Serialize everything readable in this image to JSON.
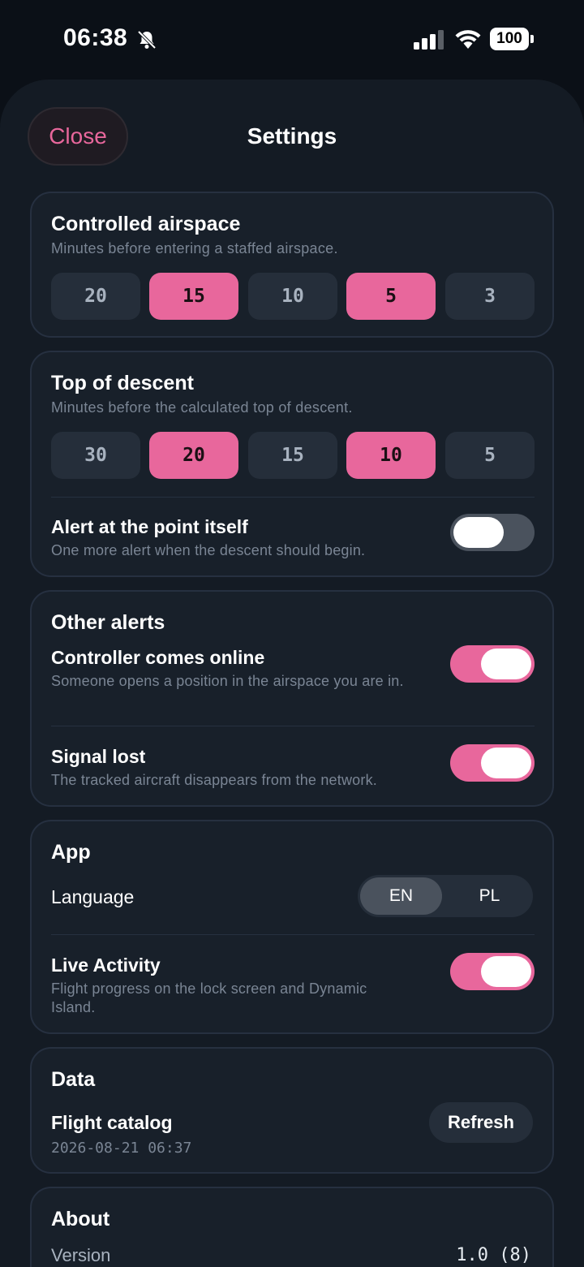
{
  "status_bar": {
    "time": "06:38",
    "battery": "100"
  },
  "header": {
    "close_label": "Close",
    "title": "Settings"
  },
  "controlled_airspace": {
    "title": "Controlled airspace",
    "subtitle": "Minutes before entering a staffed airspace.",
    "options": [
      {
        "label": "20",
        "selected": false
      },
      {
        "label": "15",
        "selected": true
      },
      {
        "label": "10",
        "selected": false
      },
      {
        "label": "5",
        "selected": true
      },
      {
        "label": "3",
        "selected": false
      }
    ]
  },
  "top_of_descent": {
    "title": "Top of descent",
    "subtitle": "Minutes before the calculated top of descent.",
    "options": [
      {
        "label": "30",
        "selected": false
      },
      {
        "label": "20",
        "selected": true
      },
      {
        "label": "15",
        "selected": false
      },
      {
        "label": "10",
        "selected": true
      },
      {
        "label": "5",
        "selected": false
      }
    ],
    "alert_point": {
      "title": "Alert at the point itself",
      "subtitle": "One more alert when the descent should begin.",
      "enabled": false
    }
  },
  "other_alerts": {
    "title": "Other alerts",
    "controller_online": {
      "title": "Controller comes online",
      "subtitle": "Someone opens a position in the airspace you are in.",
      "enabled": true
    },
    "signal_lost": {
      "title": "Signal lost",
      "subtitle": "The tracked aircraft disappears from the network.",
      "enabled": true
    }
  },
  "app": {
    "title": "App",
    "language": {
      "label": "Language",
      "options": [
        "EN",
        "PL"
      ],
      "selected": "EN"
    },
    "live_activity": {
      "title": "Live Activity",
      "subtitle": "Flight progress on the lock screen and Dynamic Island.",
      "enabled": true
    }
  },
  "data_section": {
    "title": "Data",
    "flight_catalog": {
      "title": "Flight catalog",
      "timestamp": "2026-08-21 06:37",
      "refresh_label": "Refresh"
    }
  },
  "about": {
    "title": "About",
    "version_label": "Version",
    "version_value": "1.0 (8)"
  },
  "colors": {
    "accent": "#e8679c",
    "sheet": "#141b24",
    "card": "#18202a"
  }
}
